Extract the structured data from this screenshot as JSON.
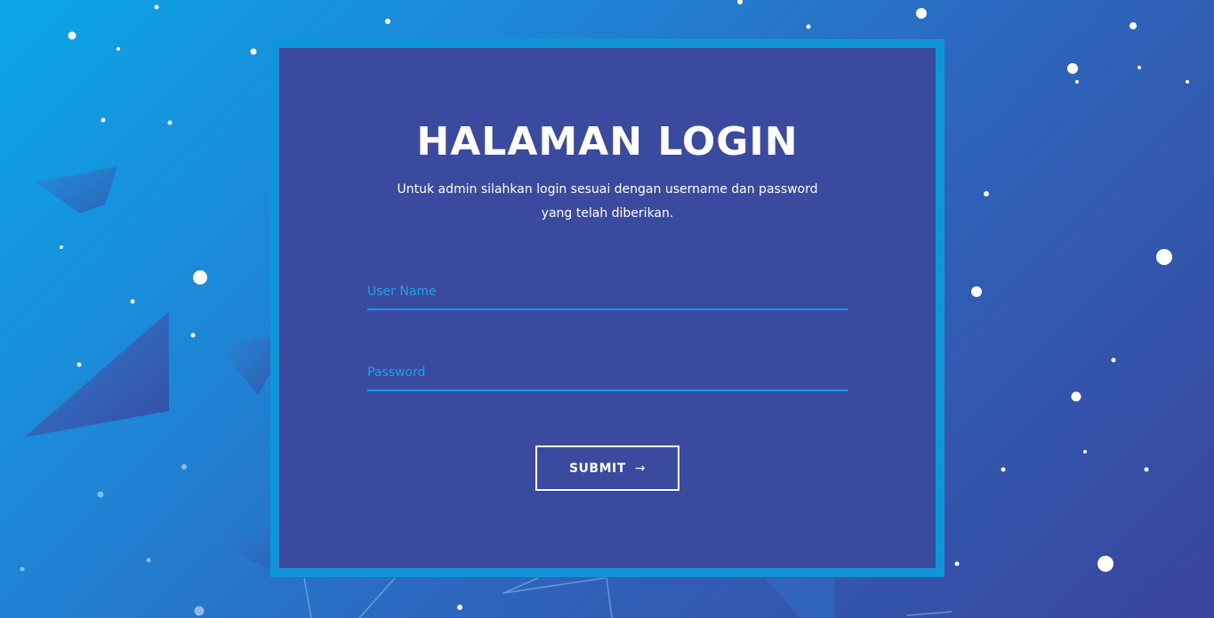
{
  "login": {
    "title": "HALAMAN LOGIN",
    "subtitle_line1": "Untuk admin silahkan login sesuai dengan username dan password",
    "subtitle_line2": "yang telah diberikan.",
    "username_placeholder": "User Name",
    "password_placeholder": "Password",
    "submit_label": "SUBMIT",
    "submit_icon": "arrow-right-icon"
  },
  "colors": {
    "background_start": "#0aa6e6",
    "background_end": "#3a449c",
    "card_border": "#1095d9",
    "card_fill": "#3a4a9e",
    "input_accent": "#0ea0e6",
    "text": "#ffffff"
  }
}
